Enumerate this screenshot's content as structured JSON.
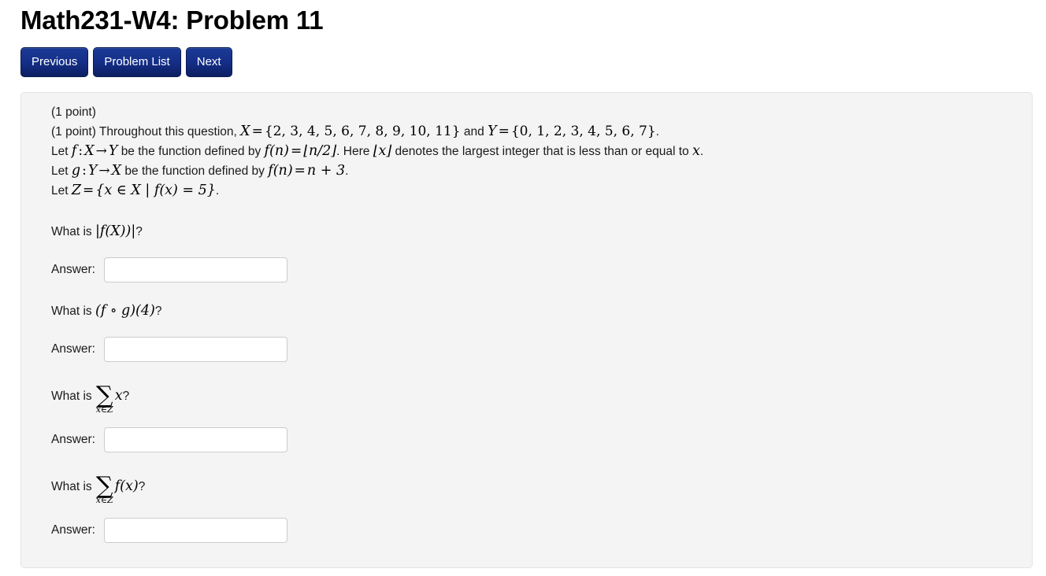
{
  "page": {
    "title": "Math231-W4: Problem 11"
  },
  "nav": {
    "buttons": [
      {
        "label": "Previous",
        "name": "previous-button"
      },
      {
        "label": "Problem List",
        "name": "problem-list-button"
      },
      {
        "label": "Next",
        "name": "next-button"
      }
    ]
  },
  "problem": {
    "points_line_1": "(1 point)",
    "points_line_2_prefix": "(1 point) Throughout this question,",
    "statements": {
      "line2": {
        "x_var": "X",
        "eq": "=",
        "x_set": "{2, 3, 4, 5, 6, 7, 8, 9, 10, 11}",
        "and": "and",
        "y_var": "Y",
        "y_set": "{0, 1, 2, 3, 4, 5, 6, 7}",
        "period": "."
      },
      "line3": {
        "let": "Let",
        "f": "f",
        "colon": ":",
        "domain": "X",
        "arrow": "→",
        "codomain": "Y",
        "text1": "be the function defined by",
        "fn": "f(n)",
        "eq": "=",
        "floor_expr": "⌊n/2⌋",
        "text2": ". Here",
        "floor_x": "⌊x⌋",
        "text3": "denotes the largest integer that is less than or equal to",
        "x": "x",
        "period": "."
      },
      "line4": {
        "let": "Let",
        "g": "g",
        "colon": ":",
        "domain": "Y",
        "arrow": "→",
        "codomain": "X",
        "text1": "be the function defined by",
        "fn": "f(n)",
        "eq": "=",
        "expr": "n + 3",
        "period": "."
      },
      "line5": {
        "let": "Let",
        "z": "Z",
        "eq": "=",
        "set": "{x ∈ X | f(x) = 5}",
        "period": "."
      }
    },
    "questions": [
      {
        "name": "question-cardinality",
        "prefix": "What is",
        "math": "|f(X))|",
        "suffix": "?",
        "type": "plain",
        "answer_label": "Answer:",
        "answer_value": "",
        "answer_placeholder": ""
      },
      {
        "name": "question-composition",
        "prefix": "What is",
        "math": "(f ∘ g)(4)",
        "suffix": "?",
        "type": "plain",
        "answer_label": "Answer:",
        "answer_value": "",
        "answer_placeholder": ""
      },
      {
        "name": "question-sum-x",
        "prefix": "What is",
        "sum_symbol": "∑",
        "sum_limit": "x∈Z",
        "math": "x",
        "suffix": "?",
        "type": "sum",
        "answer_label": "Answer:",
        "answer_value": "",
        "answer_placeholder": ""
      },
      {
        "name": "question-sum-fx",
        "prefix": "What is",
        "sum_symbol": "∑",
        "sum_limit": "x∈Z",
        "math": "f(x)",
        "suffix": "?",
        "type": "sum",
        "answer_label": "Answer:",
        "answer_value": "",
        "answer_placeholder": ""
      }
    ]
  },
  "colors": {
    "button_blue": "#15308a",
    "panel_bg": "#f4f4f4",
    "panel_border": "#e3e3e3",
    "input_border": "#cccccc",
    "text": "#1a1a1a"
  }
}
